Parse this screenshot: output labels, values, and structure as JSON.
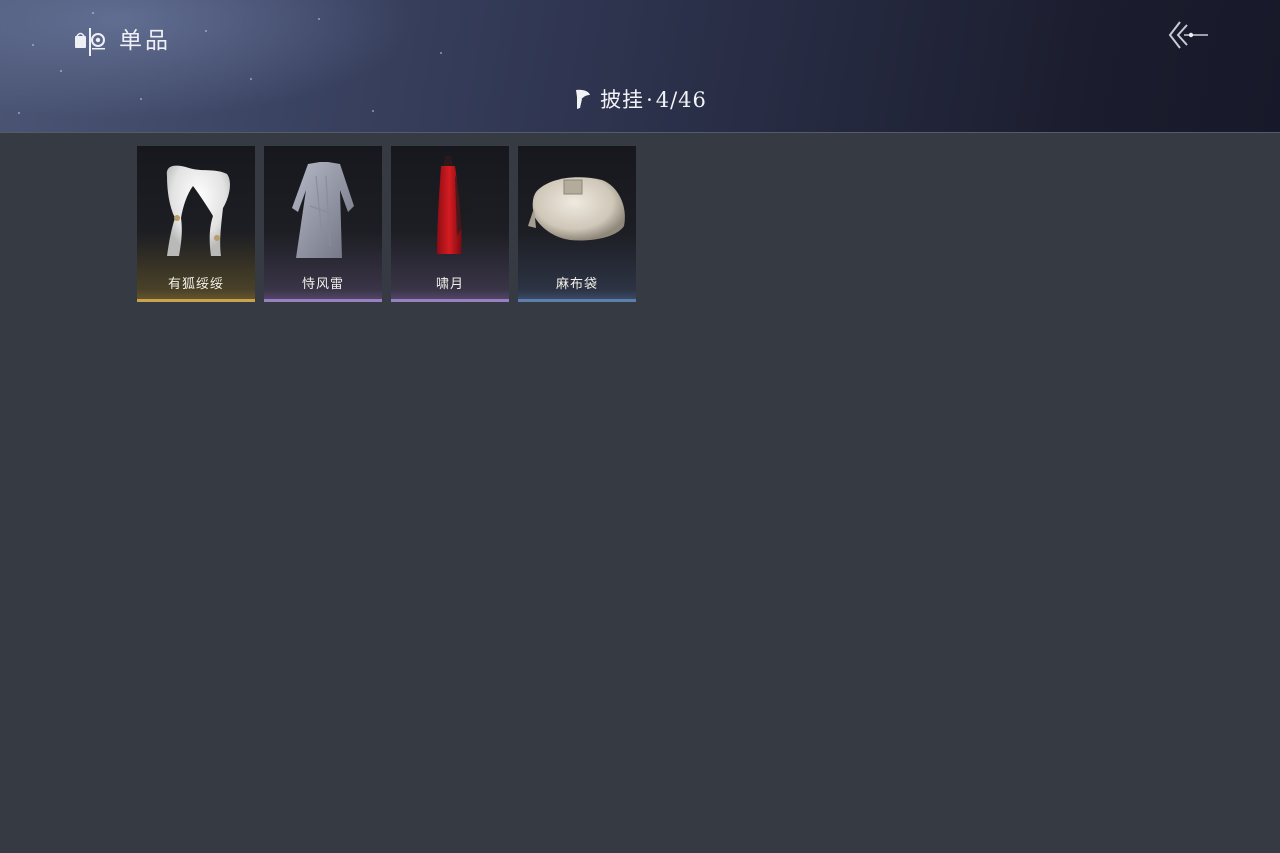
{
  "header": {
    "category_icon": "wardrobe-icon",
    "category_title": "单品",
    "back_icon": "back-arrow-icon"
  },
  "section": {
    "icon": "cape-icon",
    "title": "披挂",
    "separator": "·",
    "count": "4/46"
  },
  "items": [
    {
      "name": "有狐绥绥",
      "icon": "white-fur-scarf",
      "rarity_color": "#c9a44d"
    },
    {
      "name": "恃风雷",
      "icon": "grey-robe",
      "rarity_color": "#9a7fc1"
    },
    {
      "name": "啸月",
      "icon": "red-cape",
      "rarity_color": "#9a7fc1"
    },
    {
      "name": "麻布袋",
      "icon": "burlap-sack",
      "rarity_color": "#5d7fae"
    }
  ]
}
